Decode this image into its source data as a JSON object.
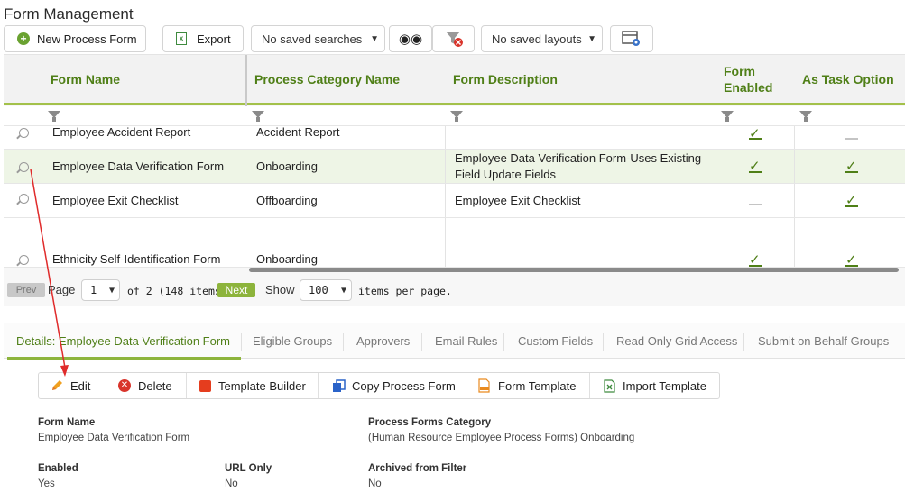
{
  "page": {
    "title": "Form Management"
  },
  "toolbar": {
    "new_label": "New Process Form",
    "export_label": "Export",
    "saved_searches": "No saved searches",
    "saved_layouts": "No saved layouts"
  },
  "grid": {
    "headers": {
      "form_name": "Form Name",
      "category": "Process Category Name",
      "description": "Form Description",
      "enabled_1": "Form",
      "enabled_2": "Enabled",
      "task": "As Task Option"
    },
    "rows": [
      {
        "name": "Employee Accident Report",
        "category": "Accident Report",
        "desc_1": "",
        "desc_2": "",
        "enabled": true,
        "task": false
      },
      {
        "name": "Employee Data Verification Form",
        "category": "Onboarding",
        "desc_1": "Employee Data Verification Form-Uses Existing",
        "desc_2": "Field Update Fields",
        "enabled": true,
        "task": true
      },
      {
        "name": "Employee Exit Checklist",
        "category": "Offboarding",
        "desc_1": "Employee Exit Checklist",
        "desc_2": "",
        "enabled": false,
        "task": true
      },
      {
        "name": "Ethnicity Self-Identification Form",
        "category": "Onboarding",
        "desc_1": "",
        "desc_2": "",
        "enabled": true,
        "task": true
      }
    ]
  },
  "pager": {
    "prev": "Prev",
    "page_word": "Page",
    "page_value": "1",
    "of_text": "of 2 (148 items)",
    "next": "Next",
    "show": "Show",
    "per_page_value": "100",
    "per_page_text": "items per page."
  },
  "tabs": [
    "Details: Employee Data Verification Form",
    "Eligible Groups",
    "Approvers",
    "Email Rules",
    "Custom Fields",
    "Read Only Grid Access",
    "Submit on Behalf Groups"
  ],
  "actions": {
    "edit": "Edit",
    "delete": "Delete",
    "template_builder": "Template Builder",
    "copy": "Copy Process Form",
    "form_template": "Form Template",
    "import": "Import Template"
  },
  "details": {
    "form_name_label": "Form Name",
    "form_name_value": "Employee Data Verification Form",
    "category_label": "Process Forms Category",
    "category_value": "(Human Resource Employee Process Forms) Onboarding",
    "enabled_label": "Enabled",
    "enabled_value": "Yes",
    "url_only_label": "URL Only",
    "url_only_value": "No",
    "archived_label": "Archived from Filter",
    "archived_value": "No"
  },
  "colors": {
    "accent": "#8db43c",
    "header_text": "#4f7f17",
    "arrow": "#e02b2b"
  }
}
